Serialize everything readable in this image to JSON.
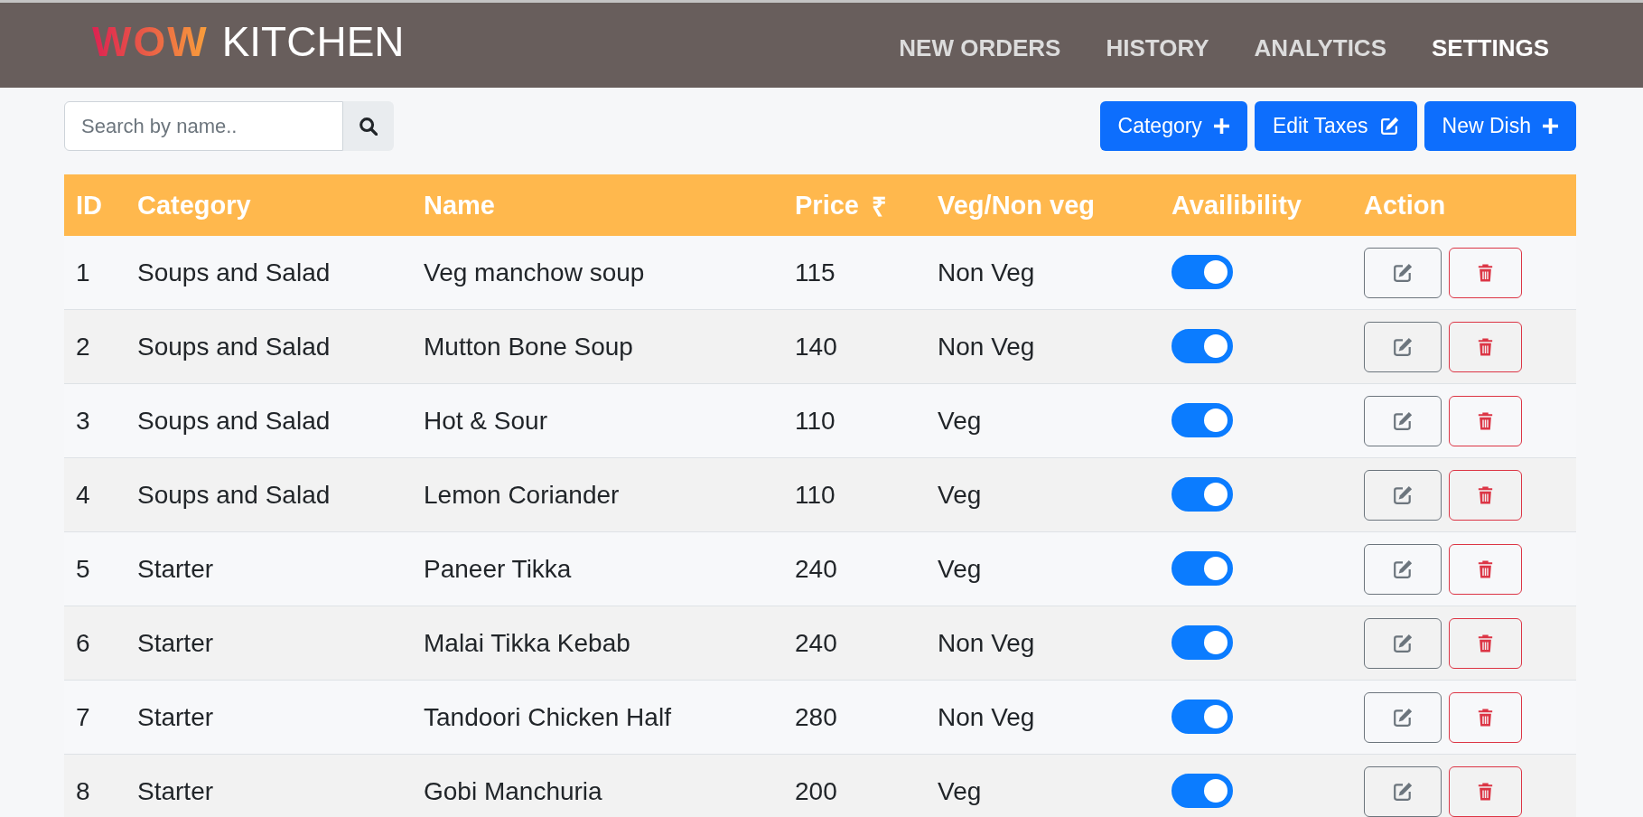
{
  "header": {
    "logo": {
      "accent": "WOW",
      "text": "KITCHEN"
    },
    "nav": [
      {
        "label": "NEW ORDERS",
        "selected": false
      },
      {
        "label": "HISTORY",
        "selected": false
      },
      {
        "label": "ANALYTICS",
        "selected": false
      },
      {
        "label": "SETTINGS",
        "selected": true
      }
    ]
  },
  "toolbar": {
    "search": {
      "placeholder": "Search by name.."
    },
    "buttons": [
      {
        "label": "Category",
        "kind": "add"
      },
      {
        "label": "Edit Taxes",
        "kind": "edit"
      },
      {
        "label": "New Dish",
        "kind": "add"
      }
    ]
  },
  "table": {
    "columns": [
      {
        "label": "ID"
      },
      {
        "label": "Category"
      },
      {
        "label": "Name"
      },
      {
        "label": "Price",
        "symbol": "₹"
      },
      {
        "label": "Veg/Non veg"
      },
      {
        "label": "Availibility"
      },
      {
        "label": "Action"
      }
    ],
    "rows": [
      {
        "id": "1",
        "category": "Soups and Salad",
        "name": "Veg manchow soup",
        "price": "115",
        "type": "Non Veg",
        "available": true
      },
      {
        "id": "2",
        "category": "Soups and Salad",
        "name": "Mutton Bone Soup",
        "price": "140",
        "type": "Non Veg",
        "available": true
      },
      {
        "id": "3",
        "category": "Soups and Salad",
        "name": "Hot & Sour",
        "price": "110",
        "type": "Veg",
        "available": true
      },
      {
        "id": "4",
        "category": "Soups and Salad",
        "name": "Lemon Coriander",
        "price": "110",
        "type": "Veg",
        "available": true
      },
      {
        "id": "5",
        "category": "Starter",
        "name": "Paneer Tikka",
        "price": "240",
        "type": "Veg",
        "available": true
      },
      {
        "id": "6",
        "category": "Starter",
        "name": "Malai Tikka Kebab",
        "price": "240",
        "type": "Non Veg",
        "available": true
      },
      {
        "id": "7",
        "category": "Starter",
        "name": "Tandoori Chicken Half",
        "price": "280",
        "type": "Non Veg",
        "available": true
      },
      {
        "id": "8",
        "category": "Starter",
        "name": "Gobi Manchuria",
        "price": "200",
        "type": "Veg",
        "available": true
      }
    ]
  }
}
